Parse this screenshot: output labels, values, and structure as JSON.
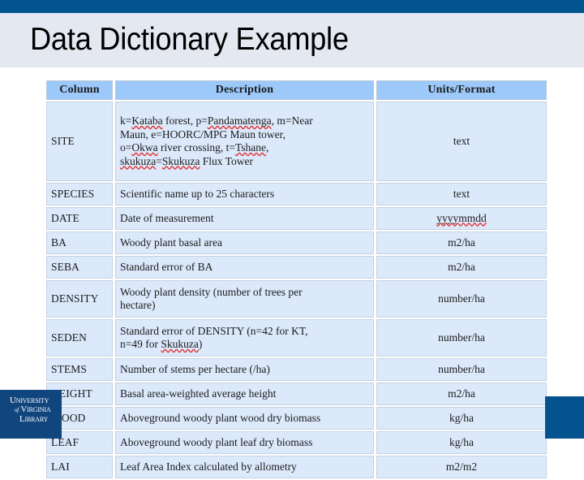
{
  "slide": {
    "title": "Data Dictionary Example",
    "accent_color": "#02548F",
    "title_band_color": "#E4E8F1",
    "table_header_color": "#9CC9FA",
    "table_cell_color": "#DCE9FB"
  },
  "logo": {
    "line1": "UNIVERSITY",
    "line2_of": "of",
    "line2": "VIRGINIA",
    "line3": "LIBRARY",
    "alt": "university-of-virginia-library-logo"
  },
  "table": {
    "headers": [
      "Column",
      "Description",
      "Units/Format"
    ],
    "rows": [
      {
        "column": "SITE",
        "description_lines": [
          "k=Kataba forest, p=Pandamatenga, m=Near",
          "Maun, e=HOORC/MPG Maun tower,",
          "o=Okwa river crossing, t=Tshane,",
          "skukuza=Skukuza Flux Tower"
        ],
        "description": "k=Kataba forest, p=Pandamatenga, m=Near Maun, e=HOORC/MPG Maun tower, o=Okwa river crossing, t=Tshane, skukuza=Skukuza Flux Tower",
        "units": "text",
        "size": "tall"
      },
      {
        "column": "SPECIES",
        "description": "Scientific name up to 25 characters",
        "units": "text",
        "size": "short"
      },
      {
        "column": "DATE",
        "description": "Date of measurement",
        "units": "yyyymmdd",
        "size": "short"
      },
      {
        "column": "BA",
        "description": "Woody plant basal area",
        "units": "m2/ha",
        "size": "short"
      },
      {
        "column": "SEBA",
        "description": "Standard error of BA",
        "units": "m2/ha",
        "size": "short"
      },
      {
        "column": "DENSITY",
        "description_lines": [
          "Woody plant density (number of trees per",
          "hectare)"
        ],
        "description": "Woody plant density (number of trees per hectare)",
        "units": "number/ha",
        "size": "mid"
      },
      {
        "column": "SEDEN",
        "description_lines": [
          "Standard error of DENSITY (n=42 for KT,",
          "n=49 for Skukuza)"
        ],
        "description": "Standard error of DENSITY (n=42 for KT, n=49 for Skukuza)",
        "units": "number/ha",
        "size": "mid"
      },
      {
        "column": "STEMS",
        "description": "Number of stems per hectare (/ha)",
        "units": "number/ha",
        "size": "short"
      },
      {
        "column": "HEIGHT",
        "description": "Basal area-weighted average height",
        "units": "m2/ha",
        "size": "short"
      },
      {
        "column": "WOOD",
        "description": "Aboveground woody plant wood dry biomass",
        "units": "kg/ha",
        "size": "short"
      },
      {
        "column": "LEAF",
        "description": "Aboveground woody plant leaf dry biomass",
        "units": "kg/ha",
        "size": "short"
      },
      {
        "column": "LAI",
        "description": "Leaf Area Index calculated by allometry",
        "units": "m2/m2",
        "size": "short"
      }
    ]
  }
}
